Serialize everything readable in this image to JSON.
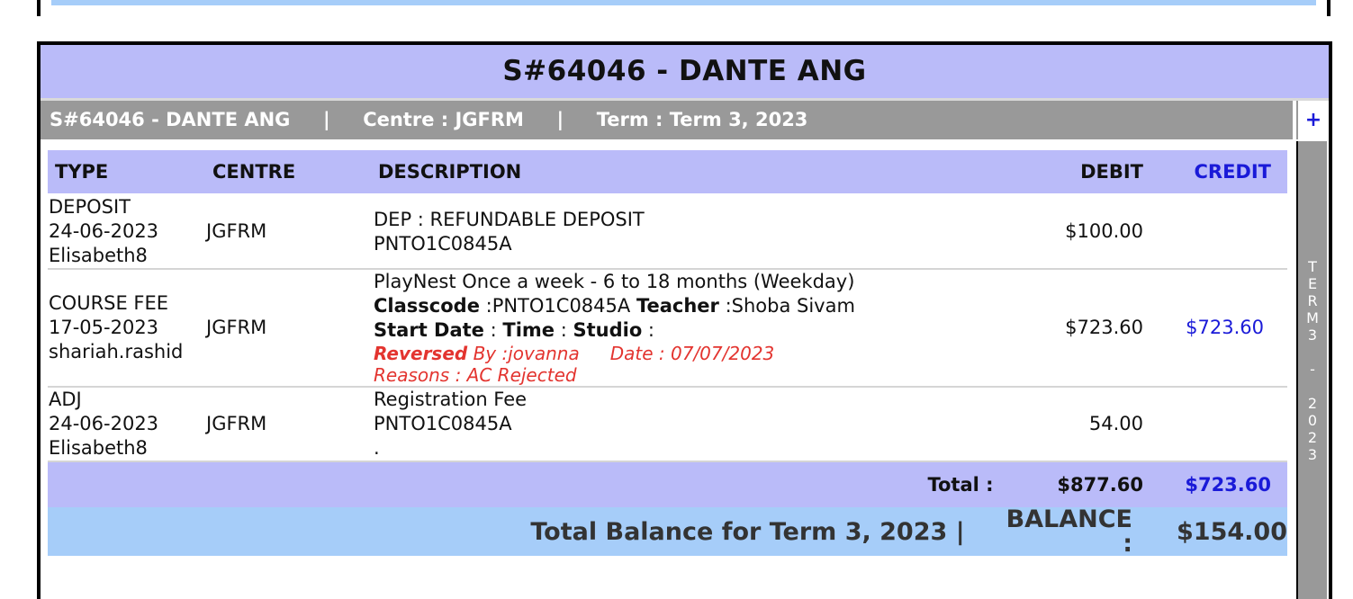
{
  "student": {
    "title": "S#64046 - DANTE ANG",
    "info": "S#64046 - DANTE ANG     |     Centre : JGFRM     |     Term : Term 3, 2023",
    "expand_label": "+"
  },
  "side_label": [
    "T",
    "E",
    "R",
    "M",
    "3",
    "",
    "-",
    "",
    "2",
    "0",
    "2",
    "3"
  ],
  "columns": {
    "type": "TYPE",
    "centre": "CENTRE",
    "description": "DESCRIPTION",
    "debit": "DEBIT",
    "credit": "CREDIT"
  },
  "rows": [
    {
      "type": "DEPOSIT",
      "date": "24-06-2023",
      "user": "Elisabeth8",
      "centre": "JGFRM",
      "desc_line1": "DEP : REFUNDABLE DEPOSIT",
      "desc_line2": "PNTO1C0845A",
      "debit": "$100.00",
      "credit": ""
    },
    {
      "type": "COURSE FEE",
      "date": "17-05-2023",
      "user": "shariah.rashid",
      "centre": "JGFRM",
      "desc_line1": "PlayNest Once a week - 6 to 18 months (Weekday)",
      "classcode_label": "Classcode",
      "classcode_value": " :PNTO1C0845A ",
      "teacher_label": "Teacher",
      "teacher_value": " :Shoba Sivam",
      "start_date_label": "Start Date",
      "time_label": "Time",
      "studio_label": "Studio",
      "reversed_label": "Reversed",
      "reversed_by": " By :jovanna",
      "reversed_date": "Date : 07/07/2023",
      "reasons": "Reasons : AC Rejected",
      "debit": "$723.60",
      "credit": "$723.60"
    },
    {
      "type": "ADJ",
      "date": "24-06-2023",
      "user": "Elisabeth8",
      "centre": "JGFRM",
      "desc_line1": "Registration Fee",
      "desc_line2": "PNTO1C0845A",
      "desc_line3": ".",
      "debit": "54.00",
      "credit": ""
    }
  ],
  "totals": {
    "label": "Total :",
    "debit": "$877.60",
    "credit": "$723.60"
  },
  "balance": {
    "label": "Total Balance for Term 3, 2023 |",
    "balance_label": "BALANCE :",
    "value": "$154.00"
  },
  "colors": {
    "header_bg": "#babbf9",
    "info_bar_bg": "#999999",
    "balance_bg": "#a6cdf9",
    "credit_blue": "#1a1ad8",
    "reversed_red": "#e3342f"
  }
}
